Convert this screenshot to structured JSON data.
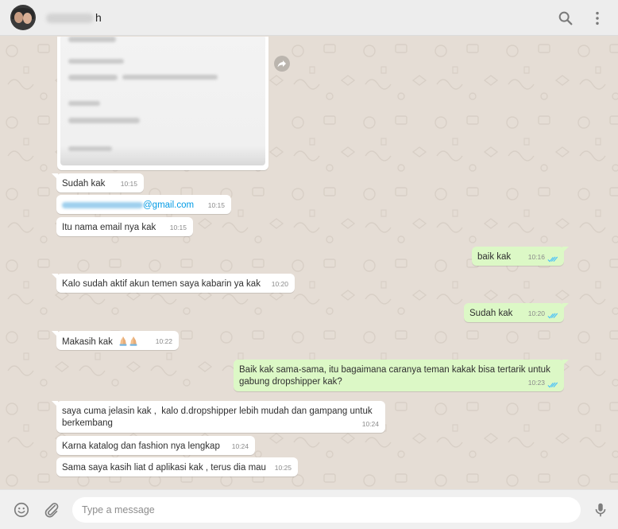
{
  "header": {
    "contact_name_suffix": "h",
    "icons": [
      "search-icon",
      "menu-icon"
    ]
  },
  "messages": [
    {
      "dir": "in",
      "text": "Sudah kak",
      "time": "10:15"
    },
    {
      "dir": "in",
      "text": "@gmail.com",
      "time": "10:15"
    },
    {
      "dir": "in",
      "text": "Itu nama email nya kak",
      "time": "10:15"
    },
    {
      "dir": "out",
      "text": "baik kak",
      "time": "10:16"
    },
    {
      "dir": "in",
      "text": "Kalo sudah aktif akun temen saya kabarin ya kak",
      "time": "10:20"
    },
    {
      "dir": "out",
      "text": "Sudah kak",
      "time": "10:20"
    },
    {
      "dir": "in",
      "text": "Makasih kak",
      "time": "10:22"
    },
    {
      "dir": "out",
      "text": "Baik kak sama-sama, itu bagaimana caranya teman kakak bisa tertarik untuk gabung dropshipper kak?",
      "time": "10:23"
    },
    {
      "dir": "in",
      "text": "saya cuma jelasin kak ,  kalo d.dropshipper lebih mudah dan gampang untuk berkembang",
      "time": "10:24"
    },
    {
      "dir": "in",
      "text": "Karna katalog dan fashion nya lengkap",
      "time": "10:24"
    },
    {
      "dir": "in",
      "text": "Sama saya kasih liat d aplikasi kak , terus dia mau",
      "time": "10:25"
    }
  ],
  "composer": {
    "placeholder": "Type a message",
    "icons": [
      "emoji-icon",
      "attach-icon",
      "mic-icon"
    ]
  },
  "colors": {
    "chat_bg": "#e5ddd5",
    "incoming_bubble": "#ffffff",
    "outgoing_bubble": "#dcf8c6",
    "read_ticks": "#4fc3f7",
    "header_bg": "#ededed"
  }
}
